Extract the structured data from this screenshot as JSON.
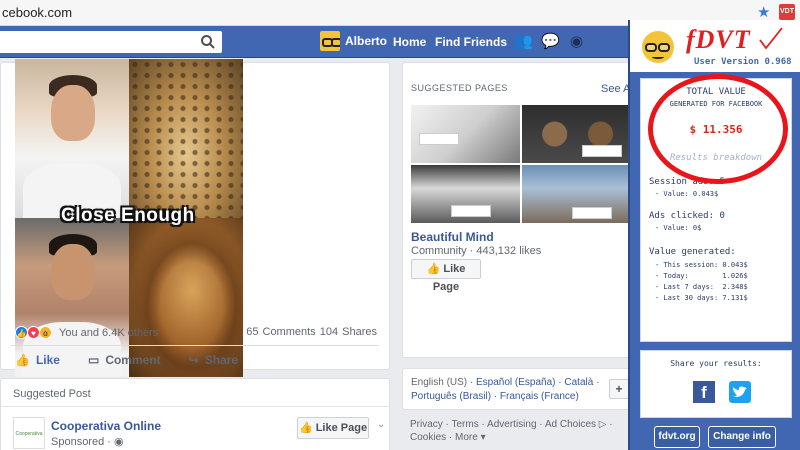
{
  "browser": {
    "url": "cebook.com"
  },
  "fb": {
    "user_name": "Alberto",
    "nav_home": "Home",
    "nav_find_friends": "Find Friends"
  },
  "post": {
    "image_caption": "Close Enough",
    "reactions_text": "You and 6.4K others",
    "counts_text": "65 Comments  104 Shares",
    "actions": {
      "like": "Like",
      "comment": "Comment",
      "share": "Share"
    }
  },
  "suggested_post": {
    "title": "Suggested Post",
    "page_name": "Cooperativa Online",
    "sponsored": "Sponsored · ",
    "like_button": "Like Page"
  },
  "suggested_pages": {
    "title": "SUGGESTED PAGES",
    "see_all": "See A",
    "page_name": "Beautiful Mind",
    "page_meta": "Community · 443,132 likes",
    "like_button": "Like Page"
  },
  "languages": {
    "line1_current": "English (US) · ",
    "line1_rest": "Español (España) · Català ·",
    "line2": "Português (Brasil) · Français (France)"
  },
  "footer": {
    "links": "Privacy · Terms · Advertising · Ad Choices ▷ · Cookies · More ▾"
  },
  "fdvt": {
    "logo": "fDVT",
    "version": "User Version 0.968",
    "total_value_title": "TOTAL VALUE",
    "total_value_sub": "GENERATED FOR FACEBOOK",
    "total_value": "$ 11.356",
    "results_breakdown": "Results breakdown",
    "session_ads": "Session ads: 5",
    "session_ads_value": "- Value: 0.043$",
    "ads_clicked": "Ads clicked: 0",
    "ads_clicked_value": "- Value: 0$",
    "value_generated": "Value generated:",
    "this_session": "- This session: 0.043$",
    "today": "- Today:        1.026$",
    "last_7": "- Last 7 days:  2.348$",
    "last_30": "- Last 30 days: 7.131$",
    "share_title": "Share your results:",
    "btn_link": "fdvt.org ↗",
    "btn_change": "Change info ©",
    "accent_red": "#e8151b",
    "fb_blue": "#4267b2"
  }
}
